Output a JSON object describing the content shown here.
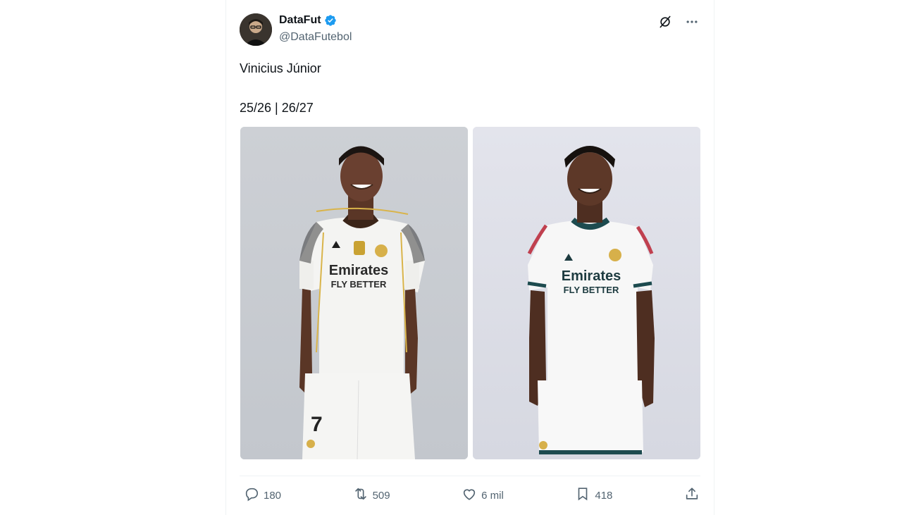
{
  "author": {
    "display_name": "DataFut",
    "handle": "@DataFutebol"
  },
  "tweet": {
    "line1": "Vinicius Júnior",
    "line2": "25/26 | 26/27"
  },
  "media": [
    {
      "sponsor": "Emirates",
      "sponsor_sub": "FLY BETTER",
      "number": "7"
    },
    {
      "sponsor": "Emirates",
      "sponsor_sub": "FLY BETTER"
    }
  ],
  "stats": {
    "replies": "180",
    "reposts": "509",
    "likes": "6 mil",
    "bookmarks": "418"
  },
  "icons": {
    "verified": "verified-badge-icon",
    "grok": "grok-icon",
    "more": "more-icon",
    "reply": "reply-icon",
    "repost": "repost-icon",
    "like": "like-icon",
    "bookmark": "bookmark-icon",
    "share": "share-icon"
  },
  "colors": {
    "verified_blue": "#1d9bf0",
    "muted_text": "#536471",
    "primary_text": "#0f1419"
  }
}
